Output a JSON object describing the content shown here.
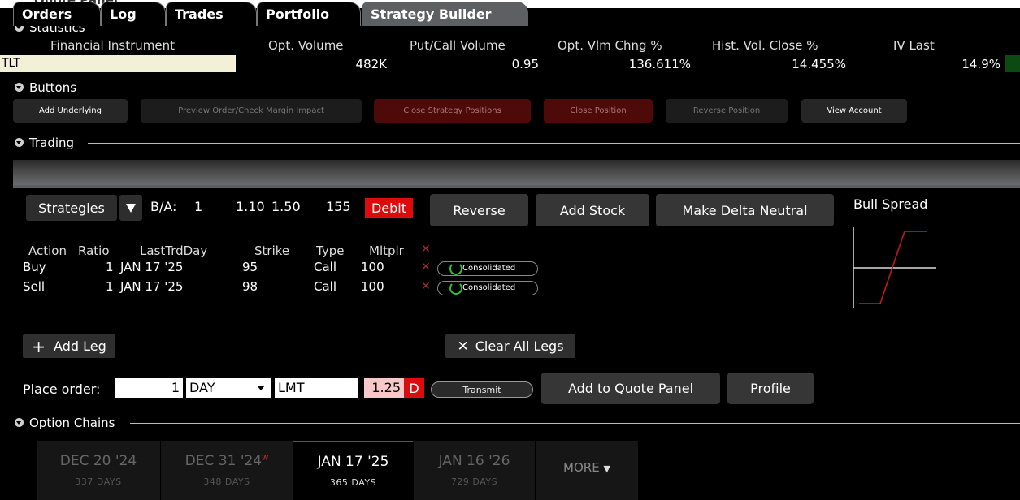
{
  "top_title": "Quote Panel",
  "sections": {
    "statistics": "Statistics",
    "buttons": "Buttons",
    "trading": "Trading",
    "option_chains": "Option Chains"
  },
  "statistics": {
    "headers": [
      "Financial Instrument",
      "Opt. Volume",
      "Put/Call Volume",
      "Opt. Vlm Chng %",
      "Hist. Vol. Close %",
      "IV Last"
    ],
    "instrument": "TLT",
    "opt_volume": "482K",
    "put_call_volume": "0.95",
    "opt_vlm_chng": "136.611%",
    "hist_vol_close": "14.455%",
    "iv_last": "14.9%"
  },
  "buttons": {
    "add_underlying": "Add Underlying",
    "preview_order": "Preview Order/Check Margin Impact",
    "close_strategy": "Close Strategy Positions",
    "close_position": "Close Position",
    "reverse_position": "Reverse Position",
    "view_account": "View Account"
  },
  "tabs": [
    "Orders",
    "Log",
    "Trades",
    "Portfolio",
    "Strategy Builder"
  ],
  "strategy_builder": {
    "strategies_label": "Strategies",
    "ba_label": "B/A:",
    "ba_qty": "1",
    "bid": "1.10",
    "ask": "1.50",
    "size": "155",
    "debit_label": "Debit",
    "reverse_label": "Reverse",
    "add_stock_label": "Add Stock",
    "delta_neutral_label": "Make Delta Neutral",
    "payoff_title": "Bull Spread",
    "columns": [
      "Action",
      "Ratio",
      "LastTrdDay",
      "Strike",
      "Type",
      "Mltplr"
    ],
    "legs": [
      {
        "action": "Buy",
        "ratio": "1",
        "last_trd_day": "JAN 17 '25",
        "strike": "95",
        "type": "Call",
        "mltplr": "100",
        "route": "Consolidated"
      },
      {
        "action": "Sell",
        "ratio": "1",
        "last_trd_day": "JAN 17 '25",
        "strike": "98",
        "type": "Call",
        "mltplr": "100",
        "route": "Consolidated"
      }
    ],
    "add_leg_label": "Add Leg",
    "clear_legs_label": "Clear All Legs"
  },
  "order": {
    "label": "Place order:",
    "quantity": "1",
    "tif": "DAY",
    "order_type": "LMT",
    "price": "1.25",
    "price_flag": "D",
    "transmit_label": "Transmit",
    "add_quote_label": "Add to Quote Panel",
    "profile_label": "Profile"
  },
  "option_chains": [
    {
      "date": "DEC 20 '24",
      "days": "337 DAYS",
      "star": ""
    },
    {
      "date": "DEC 31 '24",
      "days": "348 DAYS",
      "star": "w"
    },
    {
      "date": "JAN 17 '25",
      "days": "365 DAYS",
      "star": ""
    },
    {
      "date": "JAN 16 '26",
      "days": "729 DAYS",
      "star": ""
    }
  ],
  "more_label": "MORE",
  "colors": {
    "debit_red": "#dd0c0c",
    "instrument_bg": "#f2f0d6",
    "active_tab": "#5c6063",
    "spinner_green": "#2fbf3a"
  }
}
